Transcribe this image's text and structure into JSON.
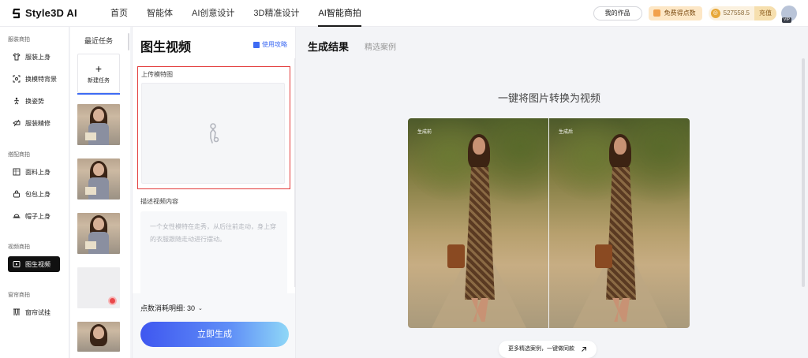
{
  "app": {
    "logo_text": "Style3D AI"
  },
  "nav": {
    "items": [
      "首页",
      "智能体",
      "AI创意设计",
      "3D精准设计",
      "AI智能商拍"
    ],
    "active_index": 4
  },
  "topright": {
    "my_works": "我的作品",
    "free_points": "免费得点数",
    "points_value": "527558.5",
    "recharge": "充值",
    "vip": "VIP"
  },
  "sidebar": {
    "groups": [
      {
        "label": "服装商拍",
        "items": [
          "服装上身",
          "换模特背景",
          "换姿势",
          "服装精修"
        ]
      },
      {
        "label": "搭配商拍",
        "items": [
          "面料上身",
          "包包上身",
          "帽子上身"
        ]
      },
      {
        "label": "视频商拍",
        "items": [
          "图生视频"
        ]
      },
      {
        "label": "窗帘商拍",
        "items": [
          "窗帘试挂"
        ]
      }
    ],
    "active_item": "图生视频"
  },
  "recent": {
    "title": "最近任务",
    "new_task_plus": "+",
    "new_task_label": "新建任务"
  },
  "panel": {
    "title": "图生视频",
    "guide": "使用攻略",
    "upload_label": "上传模特图",
    "desc_label": "描述视频内容",
    "desc_placeholder": "一个女性模特在走秀，从后往前走动，身上穿的衣服跟随走动进行摆动。",
    "cost_label": "点数消耗明细: 30",
    "generate_button": "立即生成"
  },
  "results": {
    "tab_active": "生成结果",
    "tab_inactive": "精选案例",
    "title": "一键将图片转换为视频",
    "before_label": "生成前",
    "after_label": "生成后",
    "more_cases": "更多精选案例，一键做同款"
  },
  "colors": {
    "accent": "#3e6bf3",
    "highlight_frame": "#e23a3a",
    "sidebar_active": "#111111"
  }
}
